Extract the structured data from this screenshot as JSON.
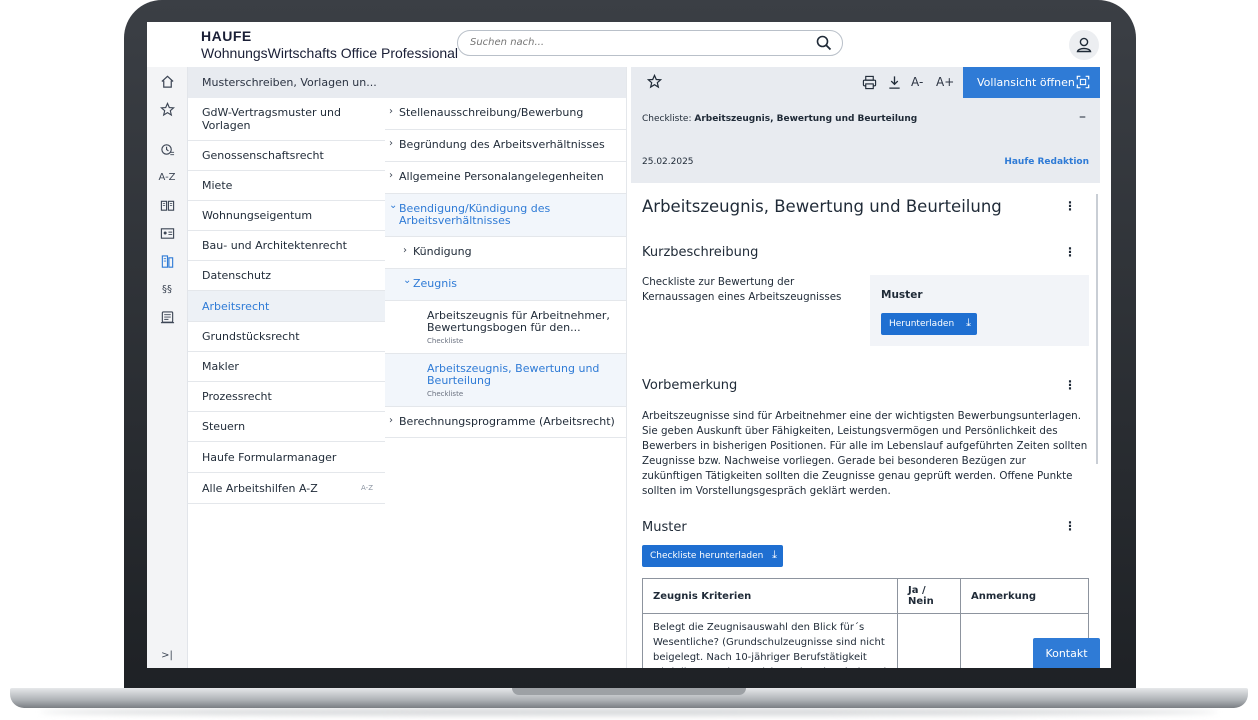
{
  "app": {
    "logo": "HAUFE",
    "product_name": "WohnungsWirtschafts Office Professional"
  },
  "search": {
    "placeholder": "Suchen nach..."
  },
  "rail": {
    "collapse_label": ">|",
    "az_label": "A-Z",
    "paragraph_label": "§§"
  },
  "col1": {
    "header": "Musterschreiben, Vorlagen un...",
    "items": [
      "GdW-Vertragsmuster und Vorlagen",
      "Genossenschaftsrecht",
      "Miete",
      "Wohnungseigentum",
      "Bau- und Architektenrecht",
      "Datenschutz",
      "Arbeitsrecht",
      "Grundstücksrecht",
      "Makler",
      "Prozessrecht",
      "Steuern",
      "Haufe Formularmanager",
      "Alle Arbeitshilfen A-Z"
    ],
    "active_item": "Arbeitsrecht",
    "az_badge": "A-Z"
  },
  "col2": {
    "items": [
      {
        "label": "Stellenausschreibung/Bewerbung"
      },
      {
        "label": "Begründung des Arbeitsverhältnisses"
      },
      {
        "label": "Allgemeine Personalangelegenheiten"
      },
      {
        "label": "Beendigung/Kündigung des Arbeitsverhältnisses"
      },
      {
        "label": "Kündigung"
      },
      {
        "label": "Zeugnis"
      },
      {
        "label": "Arbeitszeugnis für Arbeitnehmer, Bewertungsbogen für den...",
        "sub": "Checkliste"
      },
      {
        "label": "Arbeitszeugnis, Bewertung und Beurteilung",
        "sub": "Checkliste"
      },
      {
        "label": "Berechnungsprogramme (Arbeitsrecht)"
      }
    ]
  },
  "toolbar": {
    "font_smaller": "A-",
    "font_larger": "A+",
    "open_full": "Vollansicht öffnen"
  },
  "meta": {
    "type_prefix": "Checkliste:",
    "title": "Arbeitszeugnis, Bewertung und Beurteilung",
    "collapse": "–",
    "date": "25.02.2025",
    "author": "Haufe Redaktion"
  },
  "document": {
    "title": "Arbeitszeugnis, Bewertung und Beurteilung",
    "kurz": {
      "heading": "Kurzbeschreibung",
      "text": "Checkliste zur Bewertung der Kernaussagen eines Arbeitszeugnisses",
      "box_label": "Muster",
      "download_label": "Herunterladen"
    },
    "vor": {
      "heading": "Vorbemerkung",
      "text": "Arbeitszeugnisse sind für Arbeitnehmer eine der wichtigsten Bewerbungsunterlagen. Sie geben Auskunft über Fähigkeiten, Leistungsvermögen und Persönlichkeit des Bewerbers in bisherigen Positionen. Für alle im Lebenslauf aufgeführten Zeiten sollten Zeugnisse bzw. Nachweise vorliegen. Gerade bei besonderen Bezügen zur zukünftigen Tätigkeiten sollten die Zeugnisse genau geprüft werden. Offene Punkte sollten im Vorstellungsgespräch geklärt werden."
    },
    "muster": {
      "heading": "Muster",
      "download_label": "Checkliste herunterladen"
    },
    "table": {
      "headers": [
        "Zeugnis Kriterien",
        "Ja / Nein",
        "Anmerkung"
      ],
      "rows": [
        [
          "Belegt die Zeugnisauswahl den Blick für´s Wesentliche? (Grundschulzeugnisse sind nicht beigelegt. Nach 10-jähriger Berufstätigkeit wird die Bewerbung nicht mehr mit Schul- und",
          "",
          ""
        ]
      ]
    }
  },
  "kontakt_label": "Kontakt"
}
